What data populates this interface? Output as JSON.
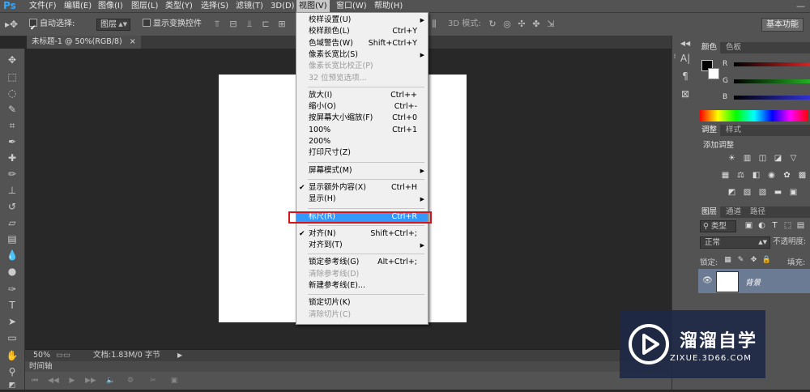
{
  "app": {
    "logo": "Ps"
  },
  "menubar": {
    "items": [
      "文件(F)",
      "编辑(E)",
      "图像(I)",
      "图层(L)",
      "类型(Y)",
      "选择(S)",
      "滤镜(T)",
      "3D(D)",
      "视图(V)",
      "窗口(W)",
      "帮助(H)"
    ],
    "active": "视图(V)"
  },
  "window_controls": {
    "minimize": "—"
  },
  "options_bar": {
    "auto_select_label": "自动选择:",
    "auto_select_value": "图层",
    "show_transform_label": "显示变换控件",
    "mode_3d_label": "3D 模式:",
    "workspace_button": "基本功能"
  },
  "document_tab": {
    "title": "未标题-1 @ 50%(RGB/8)",
    "close": "×"
  },
  "status_bar": {
    "zoom": "50%",
    "doc_info": "文档:1.83M/0 字节"
  },
  "timeline": {
    "label": "时间轴"
  },
  "view_menu": {
    "groups": [
      [
        {
          "label": "校样设置(U)",
          "shortcut": "",
          "submenu": true
        },
        {
          "label": "校样颜色(L)",
          "shortcut": "Ctrl+Y"
        },
        {
          "label": "色域警告(W)",
          "shortcut": "Shift+Ctrl+Y"
        },
        {
          "label": "像素长宽比(S)",
          "shortcut": "",
          "submenu": true
        },
        {
          "label": "像素长宽比校正(P)",
          "shortcut": "",
          "disabled": true
        },
        {
          "label": "32 位预览选项...",
          "shortcut": "",
          "disabled": true
        }
      ],
      [
        {
          "label": "放大(I)",
          "shortcut": "Ctrl++"
        },
        {
          "label": "缩小(O)",
          "shortcut": "Ctrl+-"
        },
        {
          "label": "按屏幕大小缩放(F)",
          "shortcut": "Ctrl+0"
        },
        {
          "label": "100%",
          "shortcut": "Ctrl+1"
        },
        {
          "label": "200%",
          "shortcut": ""
        },
        {
          "label": "打印尺寸(Z)",
          "shortcut": ""
        }
      ],
      [
        {
          "label": "屏幕模式(M)",
          "shortcut": "",
          "submenu": true
        }
      ],
      [
        {
          "label": "显示额外内容(X)",
          "shortcut": "Ctrl+H",
          "checked": true
        },
        {
          "label": "显示(H)",
          "shortcut": "",
          "submenu": true
        }
      ],
      [
        {
          "label": "标尺(R)",
          "shortcut": "Ctrl+R",
          "highlighted": true
        }
      ],
      [
        {
          "label": "对齐(N)",
          "shortcut": "Shift+Ctrl+;",
          "checked": true
        },
        {
          "label": "对齐到(T)",
          "shortcut": "",
          "submenu": true
        }
      ],
      [
        {
          "label": "锁定参考线(G)",
          "shortcut": "Alt+Ctrl+;"
        },
        {
          "label": "清除参考线(D)",
          "shortcut": "",
          "disabled": true
        },
        {
          "label": "新建参考线(E)...",
          "shortcut": ""
        }
      ],
      [
        {
          "label": "锁定切片(K)",
          "shortcut": ""
        },
        {
          "label": "清除切片(C)",
          "shortcut": "",
          "disabled": true
        }
      ]
    ]
  },
  "color_panel": {
    "tabs": [
      "颜色",
      "色板"
    ],
    "channels": [
      "R",
      "G",
      "B"
    ],
    "channel_colors": [
      "#ff2a2a",
      "#2ad32a",
      "#3a3aff"
    ]
  },
  "adjustments_panel": {
    "tabs": [
      "调整",
      "样式"
    ],
    "title": "添加调整"
  },
  "layers_panel": {
    "tabs": [
      "图层",
      "通道",
      "路径"
    ],
    "filter_label": "类型",
    "blend_mode": "正常",
    "opacity_label": "不透明度:",
    "lock_label": "锁定:",
    "fill_label": "填充:",
    "layer_name": "背景"
  },
  "watermark": {
    "title": "溜溜自学",
    "subtitle": "ZIXUE.3D66.COM"
  },
  "colors": {
    "highlight": "#3399ff",
    "annotation_box": "#d3141b",
    "ps_blue": "#31a8ff"
  }
}
